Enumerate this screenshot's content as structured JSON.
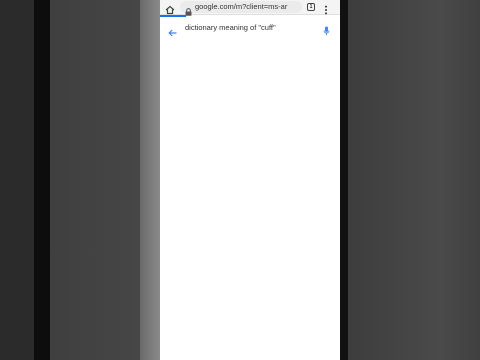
{
  "browser": {
    "url": "google.com/m?client=ms-ar",
    "tab_count": "1",
    "icons": {
      "home": "home-icon",
      "lock": "lock-icon",
      "tabs": "tabs-icon",
      "menu": "more-vert-icon"
    }
  },
  "search": {
    "query": "dictionary meaning of \"cuff\"",
    "icons": {
      "back": "back-arrow-icon",
      "voice": "mic-icon"
    }
  },
  "colors": {
    "accent": "#1a73e8",
    "background_dark": "#3f3f3f"
  }
}
